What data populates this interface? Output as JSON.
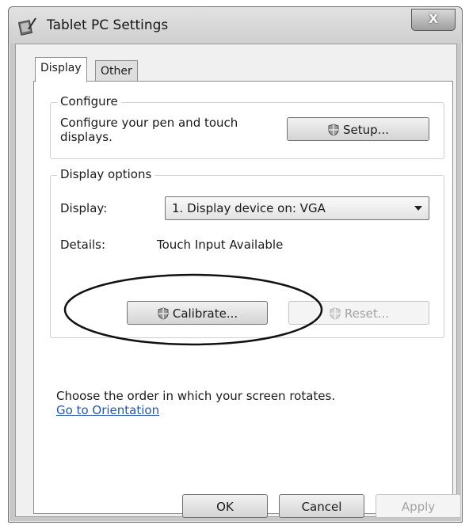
{
  "window": {
    "title": "Tablet PC Settings",
    "close_glyph": "X"
  },
  "tabs": [
    {
      "label": "Display",
      "selected": true
    },
    {
      "label": "Other",
      "selected": false
    }
  ],
  "configure": {
    "group_label": "Configure",
    "description": "Configure your pen and touch displays.",
    "setup_button": "Setup..."
  },
  "display_options": {
    "group_label": "Display options",
    "display_label": "Display:",
    "display_selected": "1. Display device on: VGA",
    "details_label": "Details:",
    "details_value": "Touch Input Available",
    "calibrate_button": "Calibrate...",
    "reset_button": "Reset..."
  },
  "orientation": {
    "text": "Choose the order in which your screen rotates.",
    "link": "Go to Orientation"
  },
  "footer": {
    "ok": "OK",
    "cancel": "Cancel",
    "apply": "Apply"
  },
  "icons": {
    "title_icon": "tablet-pen-icon",
    "shield_icon": "uac-shield-icon",
    "dropdown_icon": "chevron-down-icon"
  },
  "colors": {
    "link": "#2b56a3",
    "disabled_text": "#a3a3a3"
  }
}
